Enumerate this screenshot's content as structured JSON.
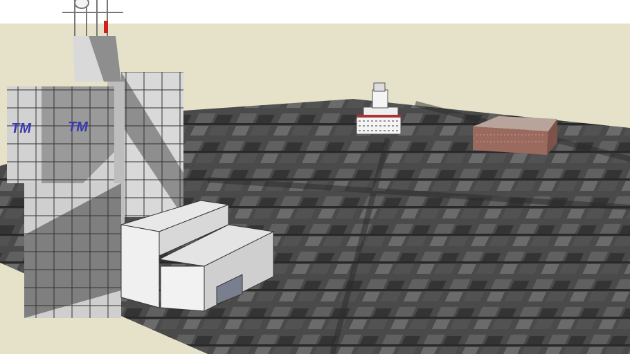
{
  "scene": {
    "logo_text": "TM",
    "colors": {
      "sky": "#ffffff",
      "ground": "#e6e2c9",
      "aerial": "#4a4a4a",
      "building_light": "#d9d9d9",
      "building_shadow": "#8e8e8e",
      "logo": "#3a3ab0",
      "brick": "#9a6a5e"
    }
  }
}
